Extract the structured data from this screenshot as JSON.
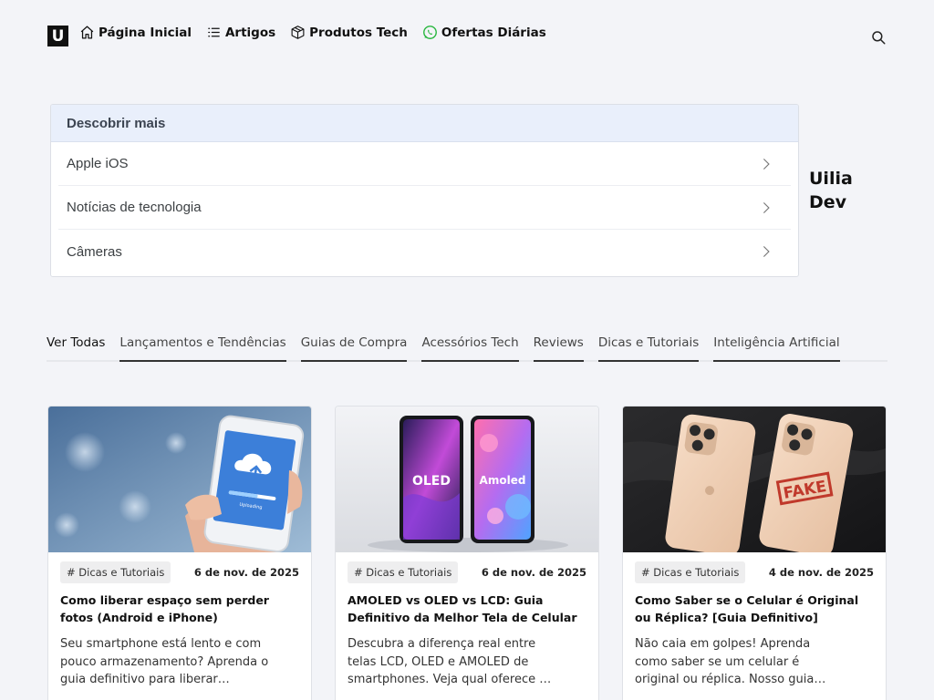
{
  "header": {
    "logo_letter": "U",
    "nav": [
      {
        "label": "Página Inicial",
        "icon": "home-icon"
      },
      {
        "label": "Artigos",
        "icon": "list-icon"
      },
      {
        "label": "Produtos Tech",
        "icon": "box-icon"
      },
      {
        "label": "Ofertas Diárias",
        "icon": "whatsapp-icon"
      }
    ]
  },
  "discover": {
    "title": "Descobrir mais",
    "items": [
      "Apple iOS",
      "Notícias de tecnologia",
      "Câmeras"
    ]
  },
  "aside": {
    "title_line1": "Uilia",
    "title_line2": "Dev"
  },
  "tabs": [
    "Ver Todas",
    "Lançamentos e Tendências",
    "Guias de Compra",
    "Acessórios Tech",
    "Reviews",
    "Dicas e Tutoriais",
    "Inteligência Artificial"
  ],
  "cards": [
    {
      "category": "# Dicas e Tutoriais",
      "date": "6 de nov. de 2025",
      "title": "Como liberar espaço sem perder fotos (Android e iPhone)",
      "desc": "Seu smartphone está lento e com pouco armazenamento? Aprenda o guia definitivo para liberar…",
      "image_text": "Uploading"
    },
    {
      "category": "# Dicas e Tutoriais",
      "date": "6 de nov. de 2025",
      "title": "AMOLED vs OLED vs LCD: Guia Definitivo da Melhor Tela de Celular e…",
      "desc": "Descubra a diferença real entre telas LCD, OLED e AMOLED de smartphones. Veja qual oferece …",
      "image_labels": [
        "OLED",
        "Amoled"
      ]
    },
    {
      "category": "# Dicas e Tutoriais",
      "date": "4 de nov. de 2025",
      "title": "Como Saber se o Celular é Original ou Réplica? [Guia Definitivo]",
      "desc": "Não caia em golpes! Aprenda como saber se um celular é original ou réplica. Nosso guia…",
      "image_stamp": "FAKE"
    }
  ]
}
